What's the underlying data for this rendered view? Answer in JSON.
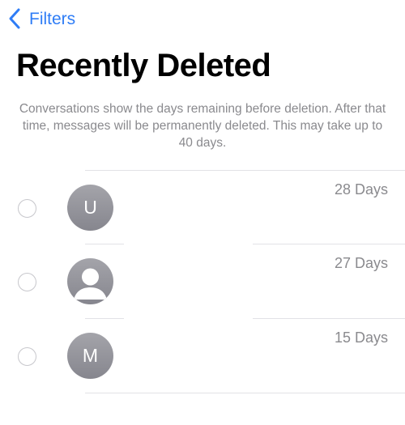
{
  "nav": {
    "back_label": "Filters"
  },
  "page": {
    "title": "Recently Deleted",
    "info": "Conversations show the days remaining before deletion. After that time, messages will be permanently deleted. This may take up to 40 days."
  },
  "conversations": [
    {
      "avatar_type": "initial",
      "initial": "U",
      "days_remaining": "28 Days"
    },
    {
      "avatar_type": "person-icon",
      "days_remaining": "27 Days"
    },
    {
      "avatar_type": "initial",
      "initial": "M",
      "days_remaining": "15 Days"
    }
  ],
  "colors": {
    "accent": "#2f7df6",
    "secondary_text": "#8a8a8e",
    "avatar_gray": "#95959b",
    "radio_border": "#c7c7cc"
  }
}
